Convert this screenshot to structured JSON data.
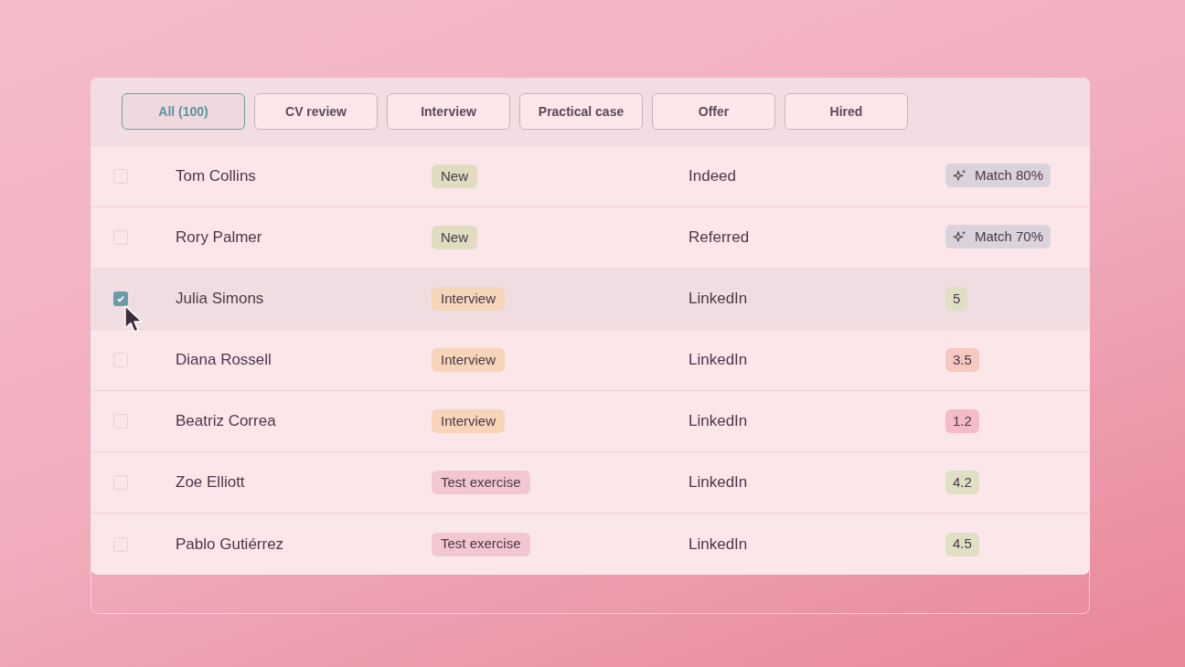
{
  "tabs": [
    {
      "label": "All (100)",
      "selected": true
    },
    {
      "label": "CV review",
      "selected": false
    },
    {
      "label": "Interview",
      "selected": false
    },
    {
      "label": "Practical case",
      "selected": false
    },
    {
      "label": "Offer",
      "selected": false
    },
    {
      "label": "Hired",
      "selected": false
    }
  ],
  "rows": [
    {
      "checked": false,
      "name": "Tom Collins",
      "stage": {
        "text": "New",
        "color": "#dfdcc0"
      },
      "source": "Indeed",
      "score": {
        "kind": "match",
        "text": "Match 80%",
        "color": "#dbd3db"
      }
    },
    {
      "checked": false,
      "name": "Rory Palmer",
      "stage": {
        "text": "New",
        "color": "#dfdcc0"
      },
      "source": "Referred",
      "score": {
        "kind": "match",
        "text": "Match 70%",
        "color": "#dbd3db"
      }
    },
    {
      "checked": true,
      "name": "Julia Simons",
      "stage": {
        "text": "Interview",
        "color": "#f6d5b9"
      },
      "source": "LinkedIn",
      "score": {
        "kind": "rating",
        "text": "5",
        "color": "#dfdfc4"
      }
    },
    {
      "checked": false,
      "name": "Diana Rossell",
      "stage": {
        "text": "Interview",
        "color": "#f6d5b9"
      },
      "source": "LinkedIn",
      "score": {
        "kind": "rating",
        "text": "3.5",
        "color": "#f5c9bf"
      }
    },
    {
      "checked": false,
      "name": "Beatriz Correa",
      "stage": {
        "text": "Interview",
        "color": "#f6d5b9"
      },
      "source": "LinkedIn",
      "score": {
        "kind": "rating",
        "text": "1.2",
        "color": "#f3bcc6"
      }
    },
    {
      "checked": false,
      "name": "Zoe Elliott",
      "stage": {
        "text": "Test exercise",
        "color": "#f3c7d1"
      },
      "source": "LinkedIn",
      "score": {
        "kind": "rating",
        "text": "4.2",
        "color": "#dfdfc4"
      }
    },
    {
      "checked": false,
      "name": "Pablo Gutiérrez",
      "stage": {
        "text": "Test exercise",
        "color": "#f3c7d1"
      },
      "source": "LinkedIn",
      "score": {
        "kind": "rating",
        "text": "4.5",
        "color": "#dfdfc4"
      }
    }
  ]
}
